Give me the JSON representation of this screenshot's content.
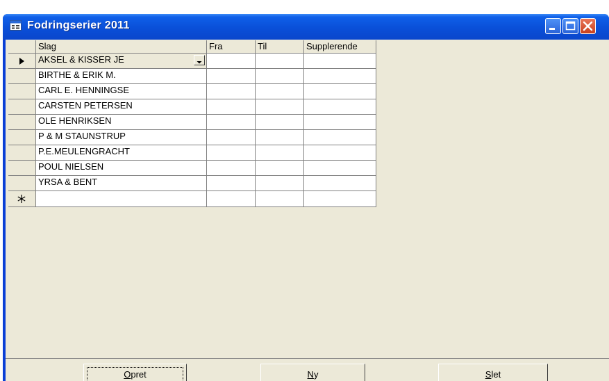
{
  "window": {
    "title": "Fodringserier 2011",
    "icon": "form-icon"
  },
  "titlebar_buttons": [
    "minimize-button",
    "maximize-button",
    "close-button"
  ],
  "grid": {
    "columns": [
      "Slag",
      "Fra",
      "Til",
      "Supplerende"
    ],
    "rows": [
      [
        "AKSEL & KISSER JE",
        "",
        "",
        ""
      ],
      [
        "BIRTHE & ERIK M.",
        "",
        "",
        ""
      ],
      [
        "CARL E. HENNINGSE",
        "",
        "",
        ""
      ],
      [
        "CARSTEN PETERSEN",
        "",
        "",
        ""
      ],
      [
        "OLE HENRIKSEN",
        "",
        "",
        ""
      ],
      [
        "P & M STAUNSTRUP",
        "",
        "",
        ""
      ],
      [
        "P.E.MEULENGRACHT",
        "",
        "",
        ""
      ],
      [
        "POUL NIELSEN",
        "",
        "",
        ""
      ],
      [
        "YRSA & BENT",
        "",
        "",
        ""
      ]
    ],
    "current_row_indicator": "triangle-pointer-icon",
    "new_row_indicator": "asterisk-icon"
  },
  "buttons": {
    "opret": {
      "label": "Opret",
      "accel": "O",
      "rest": "pret"
    },
    "ny": {
      "label": "Ny",
      "accel": "N",
      "rest": "y"
    },
    "slet": {
      "label": "Slet",
      "accel": "S",
      "rest": "let"
    }
  }
}
